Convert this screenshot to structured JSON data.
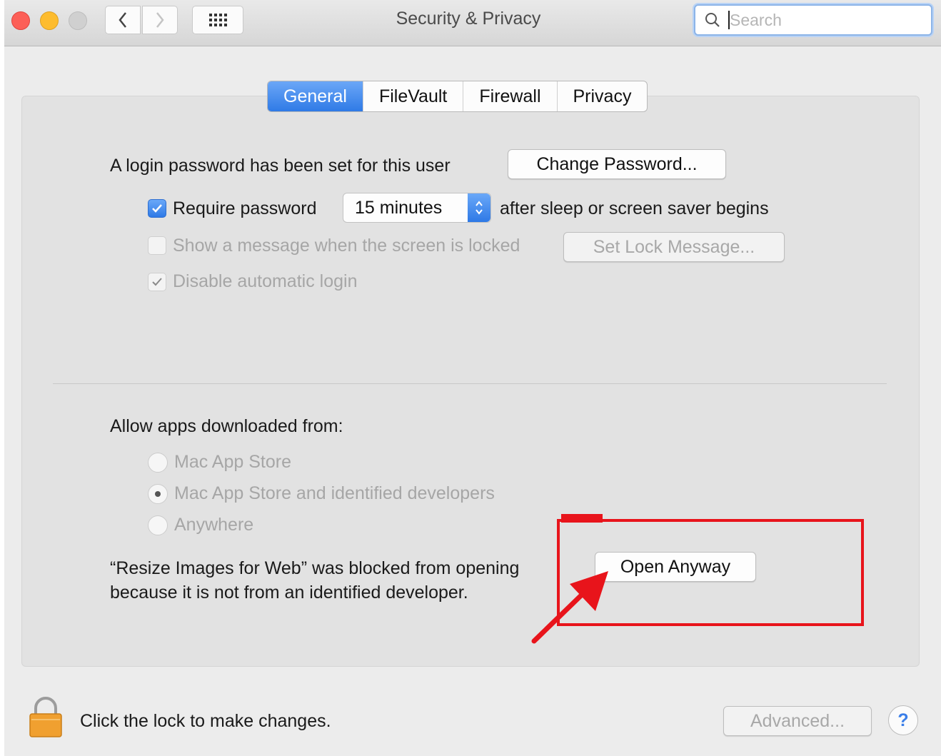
{
  "window": {
    "title": "Security & Privacy",
    "search_placeholder": "Search"
  },
  "tabs": [
    {
      "label": "General",
      "active": true
    },
    {
      "label": "FileVault",
      "active": false
    },
    {
      "label": "Firewall",
      "active": false
    },
    {
      "label": "Privacy",
      "active": false
    }
  ],
  "general": {
    "password_text": "A login password has been set for this user",
    "change_password_label": "Change Password...",
    "require_password_label": "Require password",
    "require_password_checked": true,
    "require_password_delay": "15 minutes",
    "after_sleep_text": "after sleep or screen saver begins",
    "show_message_label": "Show a message when the screen is locked",
    "show_message_checked": false,
    "set_lock_message_label": "Set Lock Message...",
    "disable_autologin_label": "Disable automatic login",
    "disable_autologin_checked": true
  },
  "allow_apps": {
    "heading": "Allow apps downloaded from:",
    "options": [
      {
        "label": "Mac App Store",
        "selected": false
      },
      {
        "label": "Mac App Store and identified developers",
        "selected": true
      },
      {
        "label": "Anywhere",
        "selected": false
      }
    ],
    "blocked_line1": "“Resize Images for Web” was blocked from opening",
    "blocked_line2": "because it is not from an identified developer.",
    "open_anyway_label": "Open Anyway"
  },
  "footer": {
    "lock_text": "Click the lock to make changes.",
    "advanced_label": "Advanced...",
    "help_label": "?"
  },
  "colors": {
    "accent": "#2f7ae6",
    "annotation_red": "#e8141b",
    "panel_bg": "#e2e2e2",
    "lock_orange": "#f0a030"
  }
}
